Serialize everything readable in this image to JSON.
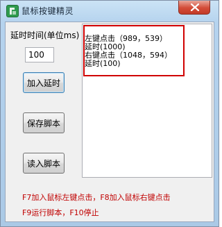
{
  "window": {
    "title": "鼠标按键精灵"
  },
  "controls": {
    "delay_label": "延时时间(单位ms)",
    "delay_value": "100",
    "add_delay_button": "加入延时",
    "save_script_button": "保存脚本",
    "load_script_button": "读入脚本"
  },
  "script": {
    "lines": [
      "左键点击（989，539）",
      "延时(1000)",
      "右键点击（1048，594）",
      "延时(100)"
    ]
  },
  "hints": {
    "line1": "F7加入鼠标左键点击，F8加入鼠标右键点击",
    "line2": "F9运行脚本，F10停止"
  },
  "colors": {
    "hint_text": "#c00000",
    "highlight_box": "#d00000",
    "title_bar": "#b5d3ee"
  },
  "icons": {
    "app": "mouse-app-icon",
    "close": "close-icon"
  }
}
